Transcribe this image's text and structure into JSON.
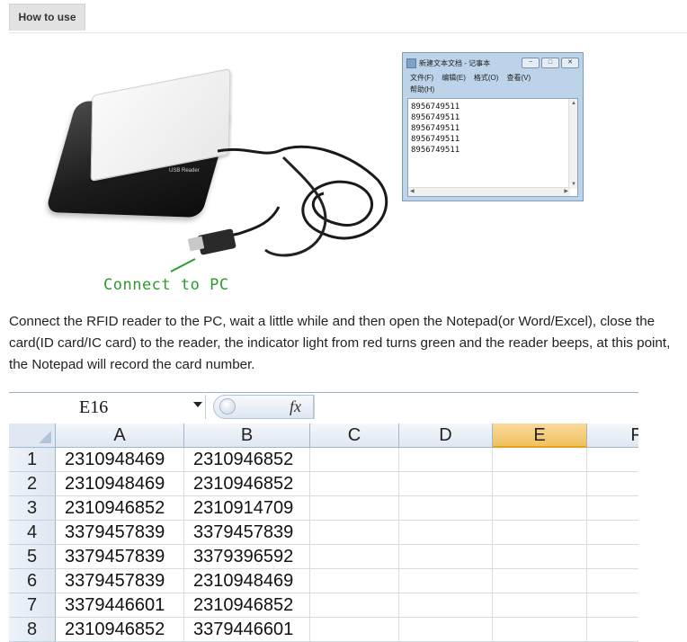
{
  "tabs": [
    {
      "label": "How to use",
      "active": true
    }
  ],
  "photo": {
    "reader_label": "USB Reader",
    "connect_label": "Connect to PC",
    "notepad": {
      "title": "新建文本文档 - 记事本",
      "controls": [
        "−",
        "□",
        "✕"
      ],
      "menu": [
        "文件(F)",
        "编辑(E)",
        "格式(O)",
        "查看(V)",
        "帮助(H)"
      ],
      "lines": [
        "8956749511",
        "8956749511",
        "8956749511",
        "8956749511",
        "8956749511"
      ]
    }
  },
  "description": "Connect the RFID reader to the PC, wait a little while and then open the Notepad(or Word/Excel), close the card(ID card/IC card) to the reader, the indicator light from red turns green and the reader beeps, at this point, the Notepad will record the card number.",
  "spreadsheet": {
    "name_box": "E16",
    "fx_label": "fx",
    "selected_column": "E",
    "columns": [
      "A",
      "B",
      "C",
      "D",
      "E",
      "F"
    ],
    "rows": [
      {
        "num": "1",
        "a": "2310948469",
        "b": "2310946852"
      },
      {
        "num": "2",
        "a": "2310948469",
        "b": "2310946852"
      },
      {
        "num": "3",
        "a": "2310946852",
        "b": "2310914709"
      },
      {
        "num": "4",
        "a": "3379457839",
        "b": "3379457839"
      },
      {
        "num": "5",
        "a": "3379457839",
        "b": "3379396592"
      },
      {
        "num": "6",
        "a": "3379457839",
        "b": "2310948469"
      },
      {
        "num": "7",
        "a": "3379446601",
        "b": "2310946852"
      },
      {
        "num": "8",
        "a": "2310946852",
        "b": "3379446601"
      }
    ]
  },
  "colors": {
    "connect_label": "#2e9b2e",
    "selected_column": "#f1c15f"
  }
}
